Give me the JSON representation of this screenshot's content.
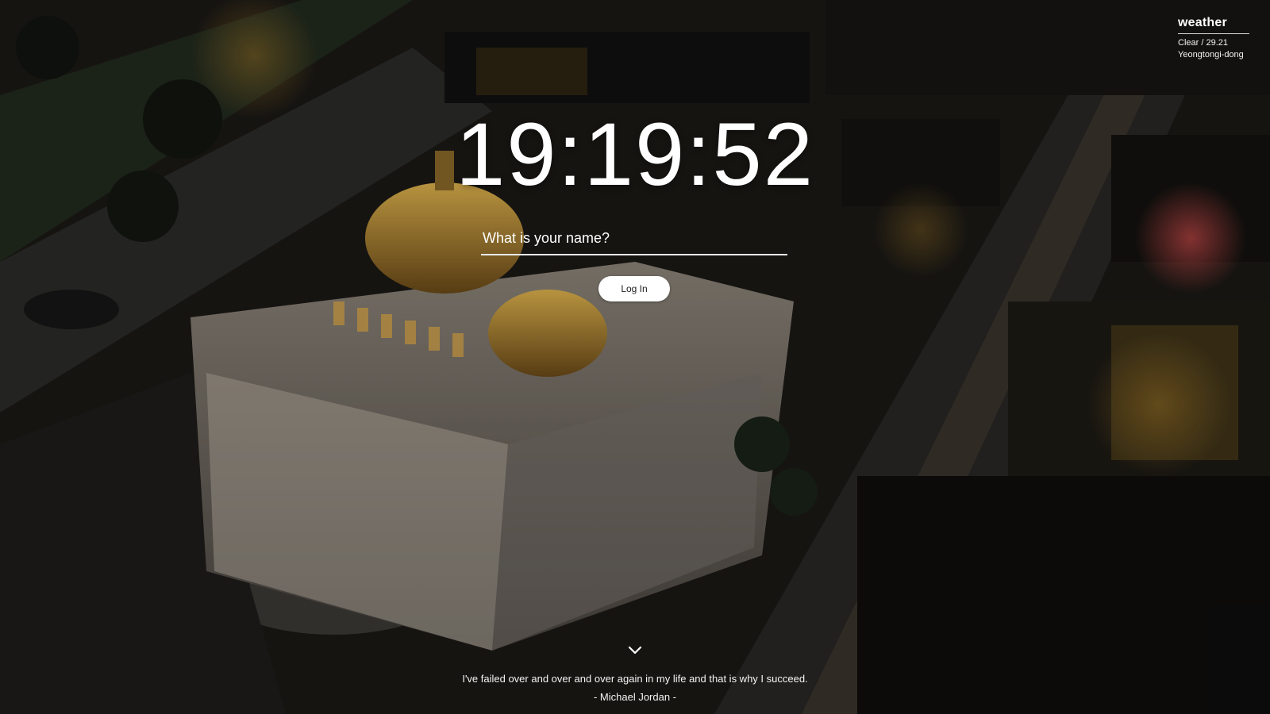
{
  "weather": {
    "title": "weather",
    "condition_temp": "Clear / 29.21",
    "location": "Yeongtongi-dong"
  },
  "clock": {
    "time": "19:19:52"
  },
  "login": {
    "placeholder": "What is your name?",
    "button_label": "Log In"
  },
  "quote": {
    "text": "I've failed over and over and over again in my life and that is why I succeed.",
    "author": "- Michael Jordan -"
  },
  "icons": {
    "scroll": "chevron-down-icon"
  },
  "colors": {
    "text": "#ffffff",
    "button_bg": "#ffffff",
    "button_text": "#222222"
  }
}
